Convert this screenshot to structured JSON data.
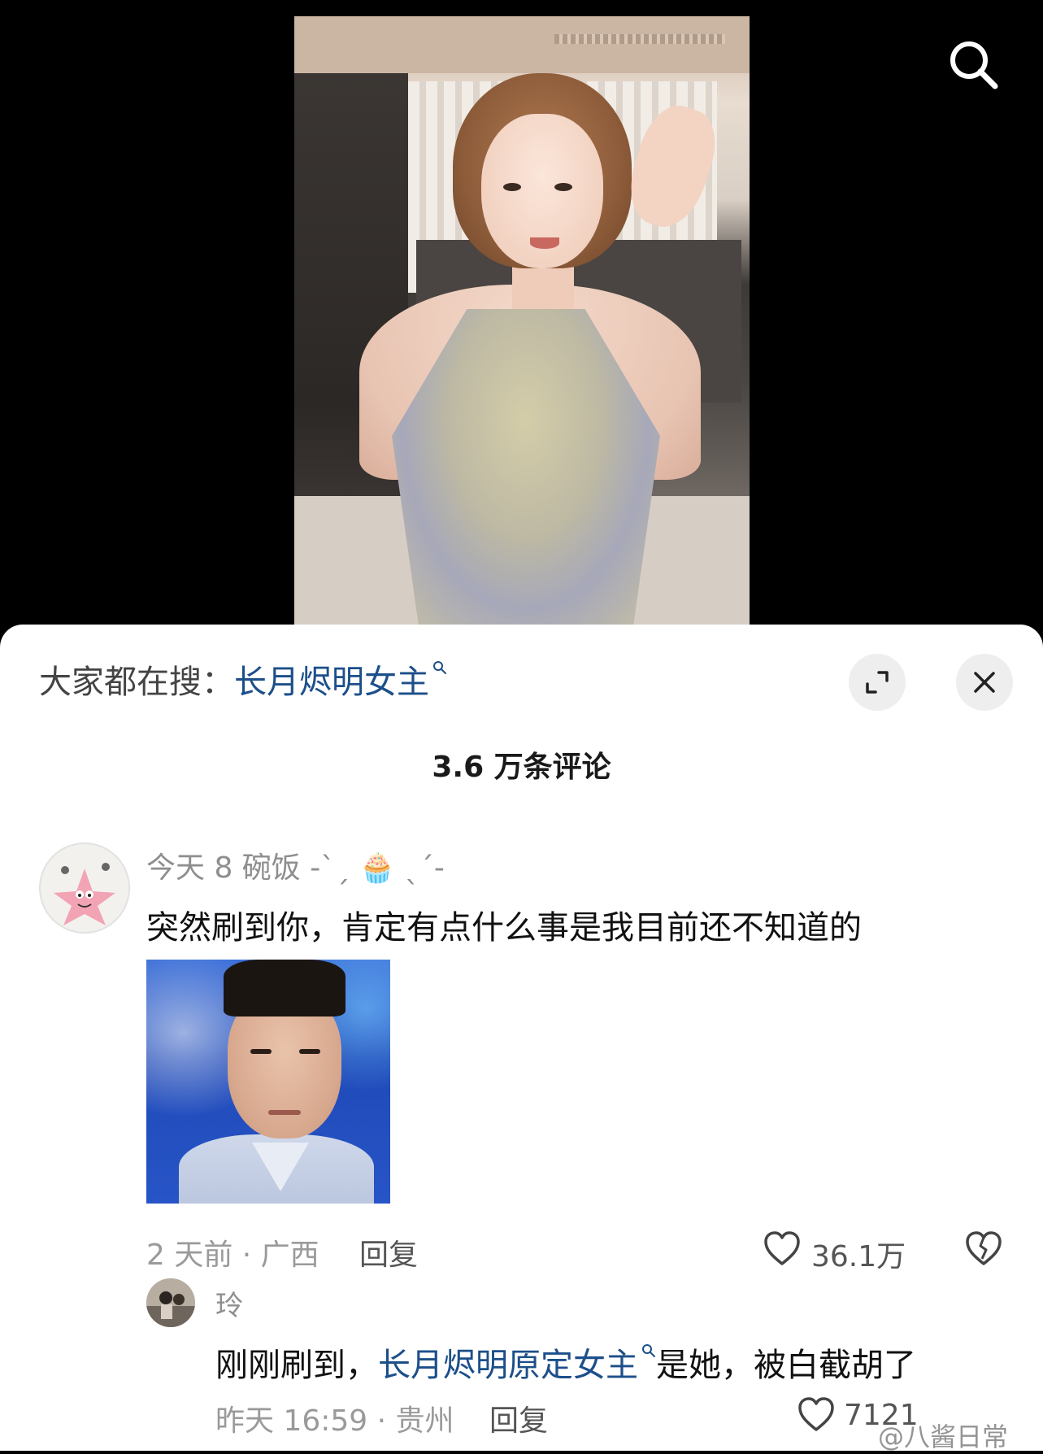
{
  "header": {
    "search_icon": "search-icon"
  },
  "sheet": {
    "hot_search_prefix": "大家都在搜：",
    "hot_search_link": "长月烬明女主",
    "expand_icon": "expand-icon",
    "close_icon": "close-icon",
    "comment_count": "3.6 万条评论"
  },
  "comments": [
    {
      "username": "今天 8 碗饭 -ˋˏ 🧁 ˎˊ-",
      "text": "突然刷到你，肯定有点什么事是我目前还不知道的",
      "has_image": true,
      "meta": "2 天前 · 广西",
      "reply_label": "回复",
      "likes": "36.1万"
    }
  ],
  "reply": {
    "username": "玲",
    "text_prefix": "刚刚刷到，",
    "text_link": "长月烬明原定女主",
    "text_suffix": "是她，被白截胡了",
    "meta": "昨天 16:59 · 贵州",
    "reply_label": "回复",
    "likes": "7121"
  },
  "watermark": "@八酱日常",
  "colors": {
    "link": "#1c4f8a",
    "background_top": "#000000",
    "sheet": "#ffffff"
  }
}
